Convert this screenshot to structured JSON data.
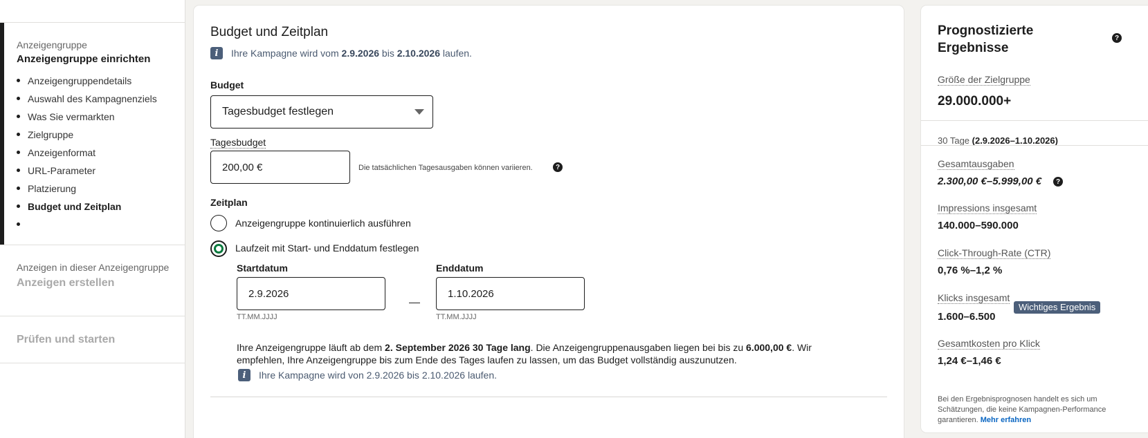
{
  "sidebar": {
    "group1": {
      "eyebrow": "Anzeigengruppe",
      "title": "Anzeigengruppe einrichten",
      "steps": [
        "Anzeigengruppendetails",
        "Auswahl des Kampagnenziels",
        "Was Sie vermarkten",
        "Zielgruppe",
        "Anzeigenformat",
        "URL-Parameter",
        "Platzierung",
        "Budget und Zeitplan"
      ],
      "current_step_index": 7
    },
    "group2": {
      "eyebrow": "Anzeigen in dieser Anzeigengruppe",
      "title": "Anzeigen erstellen"
    },
    "group3": {
      "title": "Prüfen und starten"
    }
  },
  "main": {
    "title": "Budget und Zeitplan",
    "info_top": {
      "prefix": "Ihre Kampagne wird vom ",
      "start": "2.9.2026",
      "middle": " bis ",
      "end": "2.10.2026",
      "suffix": " laufen."
    },
    "budget_label": "Budget",
    "budget_select": "Tagesbudget festlegen",
    "daily_label": "Tagesbudget",
    "daily_value": "200,00 €",
    "daily_hint": "Die tatsächlichen Tagesausgaben können variieren.",
    "schedule_label": "Zeitplan",
    "radio_continuous": "Anzeigengruppe kontinuierlich ausführen",
    "radio_range": "Laufzeit mit Start- und Enddatum festlegen",
    "start_label": "Startdatum",
    "start_value": "2.9.2026",
    "end_label": "Enddatum",
    "end_value": "1.10.2026",
    "date_format": "TT.MM.JJJJ",
    "desc": {
      "p1": "Ihre Anzeigengruppe läuft ab dem ",
      "b1": "2. September 2026 30 Tage lang",
      "p2": ". Die Anzeigengruppenausgaben liegen bei bis zu ",
      "b2": "6.000,00 €",
      "p3": ". Wir empfehlen, Ihre Anzeigengruppe bis zum Ende des Tages laufen zu lassen, um das Budget vollständig auszunutzen."
    },
    "info_bottom": "Ihre Kampagne wird von 2.9.2026 bis 2.10.2026 laufen."
  },
  "forecast": {
    "title": "Prognostizierte Ergebnisse",
    "audience_label": "Größe der Zielgruppe",
    "audience_value": "29.000.000+",
    "period_prefix": "30 Tage ",
    "period_range": "(2.9.2026–1.10.2026)",
    "spend_label": "Gesamtausgaben",
    "spend_value": "2.300,00 €–5.999,00 €",
    "impressions_label": "Impressions insgesamt",
    "impressions_value": "140.000–590.000",
    "ctr_label": "Click-Through-Rate (CTR)",
    "ctr_value": "0,76 %–1,2 %",
    "clicks_label": "Klicks insgesamt",
    "clicks_badge": "Wichtiges Ergebnis",
    "clicks_value": "1.600–6.500",
    "cpc_label": "Gesamtkosten pro Klick",
    "cpc_value": "1,24 €–1,46 €",
    "footnote": "Bei den Ergebnisprognosen handelt es sich um Schätzungen, die keine Kampagnen-Performance garantieren. ",
    "footnote_link": "Mehr erfahren"
  },
  "icons": {
    "info": "info-icon",
    "help": "help-icon",
    "caret": "chevron-down-icon"
  },
  "colors": {
    "accent_green": "#0a7a3e",
    "badge_bg": "#4c5f7a",
    "link": "#0a66c2"
  }
}
